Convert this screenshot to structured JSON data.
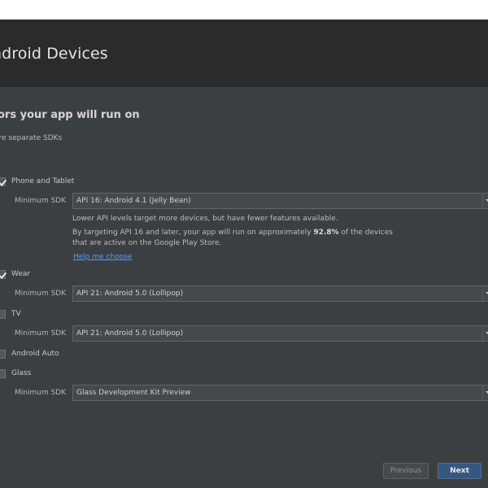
{
  "header": {
    "title": "ndroid Devices"
  },
  "subtitle": "ors your app will run on",
  "note": "ire separate SDKs",
  "form_factors": {
    "phone": {
      "label": "Phone and Tablet",
      "checked": true
    },
    "wear": {
      "label": "Wear",
      "checked": true
    },
    "tv": {
      "label": "TV",
      "checked": false
    },
    "auto": {
      "label": "Android Auto",
      "checked": false
    },
    "glass": {
      "label": "Glass",
      "checked": false
    }
  },
  "min_sdk_label": "Minimum SDK",
  "sdk_values": {
    "phone": "API 16: Android 4.1 (Jelly Bean)",
    "wear": "API 21: Android 5.0 (Lollipop)",
    "tv": "API 21: Android 5.0 (Lollipop)",
    "glass": "Glass Development Kit Preview"
  },
  "info": {
    "line1": "Lower API levels target more devices, but have fewer features available.",
    "line2a": "By targeting API 16 and later, your app will run on approximately ",
    "percent": "92.8%",
    "line2b": " of the devices",
    "line3": "that are active on the Google Play Store.",
    "help_link": "Help me choose"
  },
  "buttons": {
    "previous": "Previous",
    "next": "Next"
  }
}
